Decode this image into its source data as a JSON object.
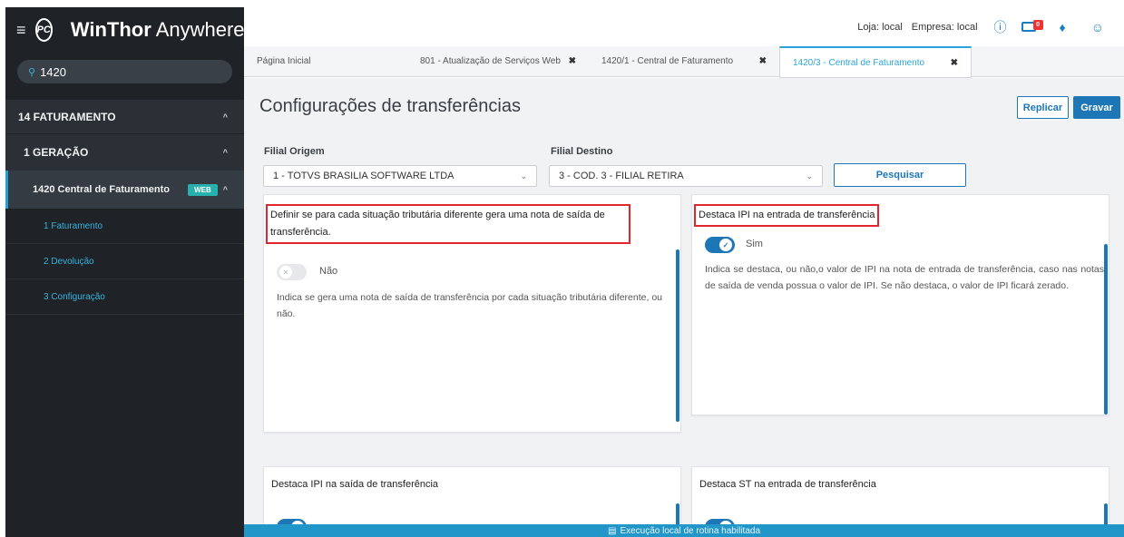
{
  "sidebar": {
    "logo_text": "PC",
    "brand_bold": "WinThor",
    "brand_light": "Anywhere",
    "search_value": "1420",
    "nav": {
      "level1": "14  FATURAMENTO",
      "level2": "1  GERAÇÃO",
      "level3": "1420  Central de Faturamento",
      "level3_badge": "WEB",
      "items": [
        {
          "label": "1  Faturamento"
        },
        {
          "label": "2  Devolução"
        },
        {
          "label": "3  Configuração"
        }
      ]
    }
  },
  "topbar": {
    "loja": "Loja: local",
    "empresa": "Empresa: local",
    "mail_count": "0"
  },
  "tabs": [
    {
      "label": "Página Inicial",
      "closable": false
    },
    {
      "label": "801 - Atualização de Serviços Web",
      "closable": true
    },
    {
      "label": "1420/1 - Central de Faturamento",
      "closable": true
    },
    {
      "label": "1420/3 - Central de Faturamento",
      "closable": true,
      "active": true
    }
  ],
  "page": {
    "title": "Configurações de transferências",
    "replicar": "Replicar",
    "gravar": "Gravar",
    "filial_origem_label": "Filial Origem",
    "filial_origem_value": "1 - TOTVS BRASILIA SOFTWARE LTDA",
    "filial_destino_label": "Filial Destino",
    "filial_destino_value": "3 - COD. 3 - FILIAL RETIRA",
    "pesquisar": "Pesquisar"
  },
  "cards": {
    "c1": {
      "title": "Definir se para cada situação tributária diferente gera uma nota de saída de transferência.",
      "toggle_label": "Não",
      "toggle_on": false,
      "desc": "Indica se gera uma nota de saída de transferência por cada situação tributária diferente, ou não."
    },
    "c2": {
      "title": "Destaca IPI na entrada de transferência",
      "toggle_label": "Sim",
      "toggle_on": true,
      "desc": "Indica se destaca, ou não,o valor de IPI na nota de entrada de transferência, caso nas notas de saída de venda possua o valor de IPI. Se não destaca, o valor de IPI ficará zerado."
    },
    "c3": {
      "title": "Destaca IPI na saída de transferência"
    },
    "c4": {
      "title": "Destaca ST na entrada de transferência"
    }
  },
  "status_bar": "Execução local de rotina habilitada",
  "colors": {
    "accent": "#1d77b7",
    "highlight_box": "#e3262e",
    "sidebar_bg": "#2b3037",
    "submenu_text": "#32b3dc"
  }
}
